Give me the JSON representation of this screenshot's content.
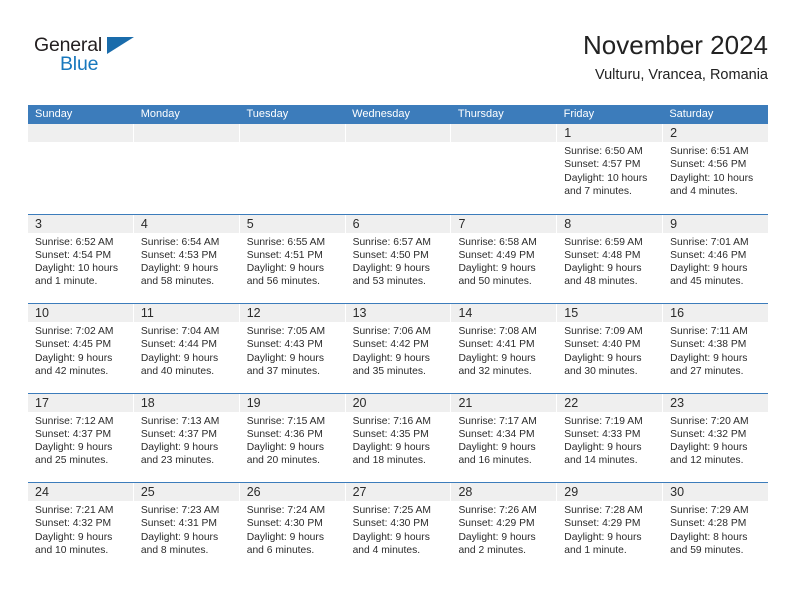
{
  "brand": {
    "word_one": "General",
    "word_two": "Blue",
    "triangle_icon": "brand-triangle-icon"
  },
  "header": {
    "title": "November 2024",
    "location": "Vulturu, Vrancea, Romania"
  },
  "colors": {
    "header_blue": "#3c7cbb",
    "brand_blue": "#1878bd",
    "day_band_gray": "#efefef",
    "text": "#2b2b2b"
  },
  "weekdays": [
    "Sunday",
    "Monday",
    "Tuesday",
    "Wednesday",
    "Thursday",
    "Friday",
    "Saturday"
  ],
  "labels": {
    "sunrise_prefix": "Sunrise:",
    "sunset_prefix": "Sunset:",
    "daylight_prefix": "Daylight:"
  },
  "weeks": [
    [
      {
        "empty": true
      },
      {
        "empty": true
      },
      {
        "empty": true
      },
      {
        "empty": true
      },
      {
        "empty": true
      },
      {
        "day": "1",
        "sunrise": "Sunrise: 6:50 AM",
        "sunset": "Sunset: 4:57 PM",
        "daylight": "Daylight: 10 hours and 7 minutes."
      },
      {
        "day": "2",
        "sunrise": "Sunrise: 6:51 AM",
        "sunset": "Sunset: 4:56 PM",
        "daylight": "Daylight: 10 hours and 4 minutes."
      }
    ],
    [
      {
        "day": "3",
        "sunrise": "Sunrise: 6:52 AM",
        "sunset": "Sunset: 4:54 PM",
        "daylight": "Daylight: 10 hours and 1 minute."
      },
      {
        "day": "4",
        "sunrise": "Sunrise: 6:54 AM",
        "sunset": "Sunset: 4:53 PM",
        "daylight": "Daylight: 9 hours and 58 minutes."
      },
      {
        "day": "5",
        "sunrise": "Sunrise: 6:55 AM",
        "sunset": "Sunset: 4:51 PM",
        "daylight": "Daylight: 9 hours and 56 minutes."
      },
      {
        "day": "6",
        "sunrise": "Sunrise: 6:57 AM",
        "sunset": "Sunset: 4:50 PM",
        "daylight": "Daylight: 9 hours and 53 minutes."
      },
      {
        "day": "7",
        "sunrise": "Sunrise: 6:58 AM",
        "sunset": "Sunset: 4:49 PM",
        "daylight": "Daylight: 9 hours and 50 minutes."
      },
      {
        "day": "8",
        "sunrise": "Sunrise: 6:59 AM",
        "sunset": "Sunset: 4:48 PM",
        "daylight": "Daylight: 9 hours and 48 minutes."
      },
      {
        "day": "9",
        "sunrise": "Sunrise: 7:01 AM",
        "sunset": "Sunset: 4:46 PM",
        "daylight": "Daylight: 9 hours and 45 minutes."
      }
    ],
    [
      {
        "day": "10",
        "sunrise": "Sunrise: 7:02 AM",
        "sunset": "Sunset: 4:45 PM",
        "daylight": "Daylight: 9 hours and 42 minutes."
      },
      {
        "day": "11",
        "sunrise": "Sunrise: 7:04 AM",
        "sunset": "Sunset: 4:44 PM",
        "daylight": "Daylight: 9 hours and 40 minutes."
      },
      {
        "day": "12",
        "sunrise": "Sunrise: 7:05 AM",
        "sunset": "Sunset: 4:43 PM",
        "daylight": "Daylight: 9 hours and 37 minutes."
      },
      {
        "day": "13",
        "sunrise": "Sunrise: 7:06 AM",
        "sunset": "Sunset: 4:42 PM",
        "daylight": "Daylight: 9 hours and 35 minutes."
      },
      {
        "day": "14",
        "sunrise": "Sunrise: 7:08 AM",
        "sunset": "Sunset: 4:41 PM",
        "daylight": "Daylight: 9 hours and 32 minutes."
      },
      {
        "day": "15",
        "sunrise": "Sunrise: 7:09 AM",
        "sunset": "Sunset: 4:40 PM",
        "daylight": "Daylight: 9 hours and 30 minutes."
      },
      {
        "day": "16",
        "sunrise": "Sunrise: 7:11 AM",
        "sunset": "Sunset: 4:38 PM",
        "daylight": "Daylight: 9 hours and 27 minutes."
      }
    ],
    [
      {
        "day": "17",
        "sunrise": "Sunrise: 7:12 AM",
        "sunset": "Sunset: 4:37 PM",
        "daylight": "Daylight: 9 hours and 25 minutes."
      },
      {
        "day": "18",
        "sunrise": "Sunrise: 7:13 AM",
        "sunset": "Sunset: 4:37 PM",
        "daylight": "Daylight: 9 hours and 23 minutes."
      },
      {
        "day": "19",
        "sunrise": "Sunrise: 7:15 AM",
        "sunset": "Sunset: 4:36 PM",
        "daylight": "Daylight: 9 hours and 20 minutes."
      },
      {
        "day": "20",
        "sunrise": "Sunrise: 7:16 AM",
        "sunset": "Sunset: 4:35 PM",
        "daylight": "Daylight: 9 hours and 18 minutes."
      },
      {
        "day": "21",
        "sunrise": "Sunrise: 7:17 AM",
        "sunset": "Sunset: 4:34 PM",
        "daylight": "Daylight: 9 hours and 16 minutes."
      },
      {
        "day": "22",
        "sunrise": "Sunrise: 7:19 AM",
        "sunset": "Sunset: 4:33 PM",
        "daylight": "Daylight: 9 hours and 14 minutes."
      },
      {
        "day": "23",
        "sunrise": "Sunrise: 7:20 AM",
        "sunset": "Sunset: 4:32 PM",
        "daylight": "Daylight: 9 hours and 12 minutes."
      }
    ],
    [
      {
        "day": "24",
        "sunrise": "Sunrise: 7:21 AM",
        "sunset": "Sunset: 4:32 PM",
        "daylight": "Daylight: 9 hours and 10 minutes."
      },
      {
        "day": "25",
        "sunrise": "Sunrise: 7:23 AM",
        "sunset": "Sunset: 4:31 PM",
        "daylight": "Daylight: 9 hours and 8 minutes."
      },
      {
        "day": "26",
        "sunrise": "Sunrise: 7:24 AM",
        "sunset": "Sunset: 4:30 PM",
        "daylight": "Daylight: 9 hours and 6 minutes."
      },
      {
        "day": "27",
        "sunrise": "Sunrise: 7:25 AM",
        "sunset": "Sunset: 4:30 PM",
        "daylight": "Daylight: 9 hours and 4 minutes."
      },
      {
        "day": "28",
        "sunrise": "Sunrise: 7:26 AM",
        "sunset": "Sunset: 4:29 PM",
        "daylight": "Daylight: 9 hours and 2 minutes."
      },
      {
        "day": "29",
        "sunrise": "Sunrise: 7:28 AM",
        "sunset": "Sunset: 4:29 PM",
        "daylight": "Daylight: 9 hours and 1 minute."
      },
      {
        "day": "30",
        "sunrise": "Sunrise: 7:29 AM",
        "sunset": "Sunset: 4:28 PM",
        "daylight": "Daylight: 8 hours and 59 minutes."
      }
    ]
  ]
}
